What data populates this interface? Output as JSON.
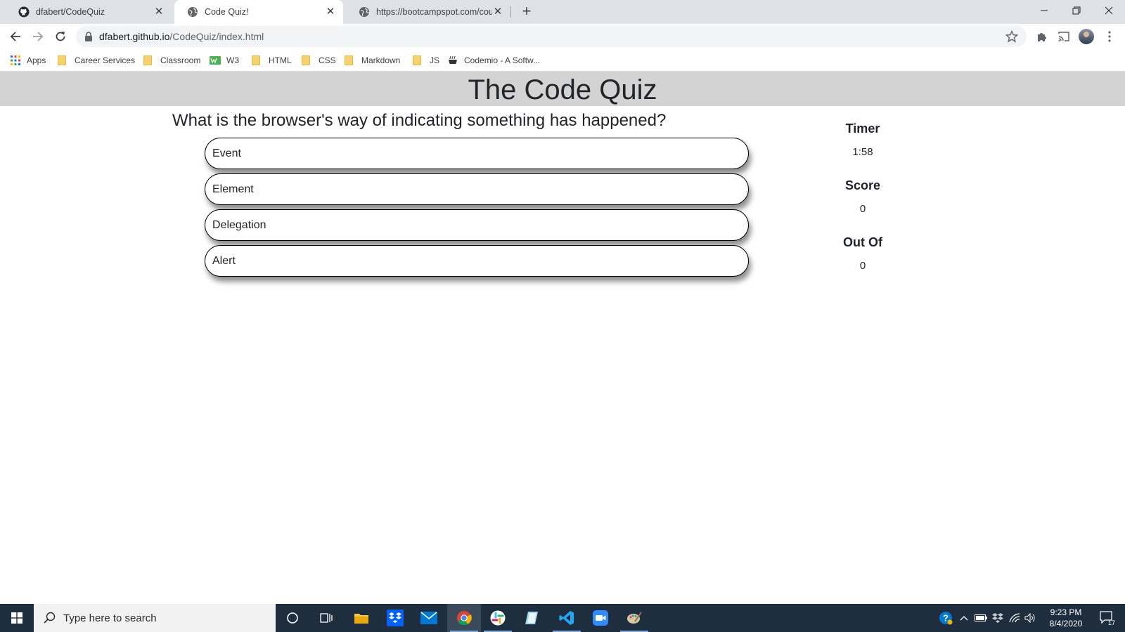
{
  "browser": {
    "tabs": [
      {
        "title": "dfabert/CodeQuiz",
        "icon": "github-icon",
        "active": false
      },
      {
        "title": "Code Quiz!",
        "icon": "globe-icon",
        "active": true
      },
      {
        "title": "https://bootcampspot.com/cours",
        "icon": "globe-icon",
        "active": false
      }
    ],
    "new_tab_label": "+",
    "address": {
      "host": "dfabert.github.io",
      "path": "/CodeQuiz/index.html"
    },
    "bookmarks": [
      {
        "label": "Apps",
        "icon": "apps-grid-icon"
      },
      {
        "label": "Career Services",
        "icon": "folder-icon"
      },
      {
        "label": "Classroom",
        "icon": "folder-icon"
      },
      {
        "label": "W3",
        "icon": "w3-icon"
      },
      {
        "label": "HTML",
        "icon": "folder-icon"
      },
      {
        "label": "CSS",
        "icon": "folder-icon"
      },
      {
        "label": "Markdown",
        "icon": "folder-icon"
      },
      {
        "label": "JS",
        "icon": "folder-icon"
      },
      {
        "label": "Codemio - A Softw...",
        "icon": "codemio-icon"
      }
    ]
  },
  "quiz": {
    "title": "The Code Quiz",
    "question": "What is the browser's way of indicating something has happened?",
    "answers": [
      "Event",
      "Element",
      "Delegation",
      "Alert"
    ],
    "sidebar": {
      "timer_label": "Timer",
      "timer_value": "1:58",
      "score_label": "Score",
      "score_value": "0",
      "outof_label": "Out Of",
      "outof_value": "0"
    }
  },
  "taskbar": {
    "search_placeholder": "Type here to search",
    "time": "9:23 PM",
    "date": "8/4/2020",
    "notification_count": "17"
  },
  "colors": {
    "header_bg": "#d3d3d3",
    "taskbar_bg": "#1f2e3e",
    "tabstrip_bg": "#dee1e6"
  }
}
